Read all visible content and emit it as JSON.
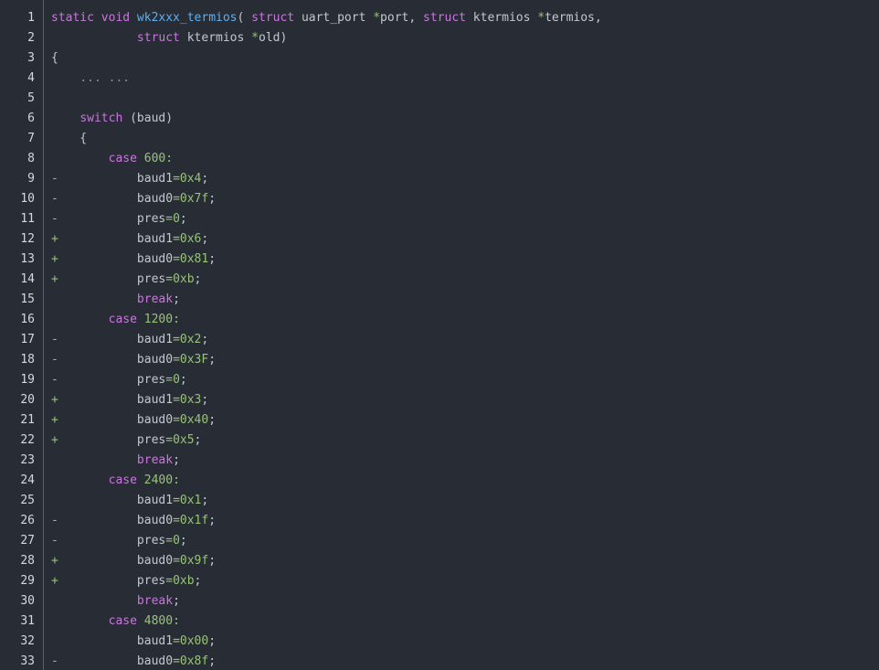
{
  "colors": {
    "background": "#282c34",
    "keyword": "#c678dd",
    "function": "#61afef",
    "number": "#98c379",
    "plain": "#c3c8d0",
    "line_number": "#d5d8de"
  },
  "lines": [
    {
      "n": "1",
      "tokens": [
        [
          "kw",
          "static void "
        ],
        [
          "fn",
          "wk2xxx_termios"
        ],
        [
          "plain",
          "( "
        ],
        [
          "kw",
          "struct"
        ],
        [
          "plain",
          " uart_port "
        ],
        [
          "op",
          "*"
        ],
        [
          "plain",
          "port, "
        ],
        [
          "kw",
          "struct"
        ],
        [
          "plain",
          " ktermios "
        ],
        [
          "op",
          "*"
        ],
        [
          "plain",
          "termios,"
        ]
      ]
    },
    {
      "n": "2",
      "tokens": [
        [
          "plain",
          "            "
        ],
        [
          "kw",
          "struct"
        ],
        [
          "plain",
          " ktermios "
        ],
        [
          "op",
          "*"
        ],
        [
          "plain",
          "old)"
        ]
      ]
    },
    {
      "n": "3",
      "tokens": [
        [
          "plain",
          "{"
        ]
      ]
    },
    {
      "n": "4",
      "tokens": [
        [
          "plain",
          "    "
        ],
        [
          "dots",
          "... ..."
        ]
      ]
    },
    {
      "n": "5",
      "tokens": []
    },
    {
      "n": "6",
      "tokens": [
        [
          "plain",
          "    "
        ],
        [
          "kw",
          "switch"
        ],
        [
          "plain",
          " (baud)"
        ]
      ]
    },
    {
      "n": "7",
      "tokens": [
        [
          "plain",
          "    {"
        ]
      ]
    },
    {
      "n": "8",
      "tokens": [
        [
          "plain",
          "        "
        ],
        [
          "kw",
          "case"
        ],
        [
          "plain",
          " "
        ],
        [
          "num",
          "600"
        ],
        [
          "op",
          ":"
        ]
      ]
    },
    {
      "n": "9",
      "tokens": [
        [
          "diff",
          "-"
        ],
        [
          "plain",
          "           baud1"
        ],
        [
          "op",
          "="
        ],
        [
          "num",
          "0x4"
        ],
        [
          "plain",
          ";"
        ]
      ]
    },
    {
      "n": "10",
      "tokens": [
        [
          "diff",
          "-"
        ],
        [
          "plain",
          "           baud0"
        ],
        [
          "op",
          "="
        ],
        [
          "num",
          "0x7f"
        ],
        [
          "plain",
          ";"
        ]
      ]
    },
    {
      "n": "11",
      "tokens": [
        [
          "diff",
          "-"
        ],
        [
          "plain",
          "           pres"
        ],
        [
          "op",
          "="
        ],
        [
          "num",
          "0"
        ],
        [
          "plain",
          ";"
        ]
      ]
    },
    {
      "n": "12",
      "tokens": [
        [
          "diff",
          "+"
        ],
        [
          "plain",
          "           baud1"
        ],
        [
          "op",
          "="
        ],
        [
          "num",
          "0x6"
        ],
        [
          "plain",
          ";"
        ]
      ]
    },
    {
      "n": "13",
      "tokens": [
        [
          "diff",
          "+"
        ],
        [
          "plain",
          "           baud0"
        ],
        [
          "op",
          "="
        ],
        [
          "num",
          "0x81"
        ],
        [
          "plain",
          ";"
        ]
      ]
    },
    {
      "n": "14",
      "tokens": [
        [
          "diff",
          "+"
        ],
        [
          "plain",
          "           pres"
        ],
        [
          "op",
          "="
        ],
        [
          "num",
          "0xb"
        ],
        [
          "plain",
          ";"
        ]
      ]
    },
    {
      "n": "15",
      "tokens": [
        [
          "plain",
          "            "
        ],
        [
          "kw",
          "break"
        ],
        [
          "plain",
          ";"
        ]
      ]
    },
    {
      "n": "16",
      "tokens": [
        [
          "plain",
          "        "
        ],
        [
          "kw",
          "case"
        ],
        [
          "plain",
          " "
        ],
        [
          "num",
          "1200"
        ],
        [
          "op",
          ":"
        ]
      ]
    },
    {
      "n": "17",
      "tokens": [
        [
          "diff",
          "-"
        ],
        [
          "plain",
          "           baud1"
        ],
        [
          "op",
          "="
        ],
        [
          "num",
          "0x2"
        ],
        [
          "plain",
          ";"
        ]
      ]
    },
    {
      "n": "18",
      "tokens": [
        [
          "diff",
          "-"
        ],
        [
          "plain",
          "           baud0"
        ],
        [
          "op",
          "="
        ],
        [
          "num",
          "0x3F"
        ],
        [
          "plain",
          ";"
        ]
      ]
    },
    {
      "n": "19",
      "tokens": [
        [
          "diff",
          "-"
        ],
        [
          "plain",
          "           pres"
        ],
        [
          "op",
          "="
        ],
        [
          "num",
          "0"
        ],
        [
          "plain",
          ";"
        ]
      ]
    },
    {
      "n": "20",
      "tokens": [
        [
          "diff",
          "+"
        ],
        [
          "plain",
          "           baud1"
        ],
        [
          "op",
          "="
        ],
        [
          "num",
          "0x3"
        ],
        [
          "plain",
          ";"
        ]
      ]
    },
    {
      "n": "21",
      "tokens": [
        [
          "diff",
          "+"
        ],
        [
          "plain",
          "           baud0"
        ],
        [
          "op",
          "="
        ],
        [
          "num",
          "0x40"
        ],
        [
          "plain",
          ";"
        ]
      ]
    },
    {
      "n": "22",
      "tokens": [
        [
          "diff",
          "+"
        ],
        [
          "plain",
          "           pres"
        ],
        [
          "op",
          "="
        ],
        [
          "num",
          "0x5"
        ],
        [
          "plain",
          ";"
        ]
      ]
    },
    {
      "n": "23",
      "tokens": [
        [
          "plain",
          "            "
        ],
        [
          "kw",
          "break"
        ],
        [
          "plain",
          ";"
        ]
      ]
    },
    {
      "n": "24",
      "tokens": [
        [
          "plain",
          "        "
        ],
        [
          "kw",
          "case"
        ],
        [
          "plain",
          " "
        ],
        [
          "num",
          "2400"
        ],
        [
          "op",
          ":"
        ]
      ]
    },
    {
      "n": "25",
      "tokens": [
        [
          "plain",
          "            baud1"
        ],
        [
          "op",
          "="
        ],
        [
          "num",
          "0x1"
        ],
        [
          "plain",
          ";"
        ]
      ]
    },
    {
      "n": "26",
      "tokens": [
        [
          "diff",
          "-"
        ],
        [
          "plain",
          "           baud0"
        ],
        [
          "op",
          "="
        ],
        [
          "num",
          "0x1f"
        ],
        [
          "plain",
          ";"
        ]
      ]
    },
    {
      "n": "27",
      "tokens": [
        [
          "diff",
          "-"
        ],
        [
          "plain",
          "           pres"
        ],
        [
          "op",
          "="
        ],
        [
          "num",
          "0"
        ],
        [
          "plain",
          ";"
        ]
      ]
    },
    {
      "n": "28",
      "tokens": [
        [
          "diff",
          "+"
        ],
        [
          "plain",
          "           baud0"
        ],
        [
          "op",
          "="
        ],
        [
          "num",
          "0x9f"
        ],
        [
          "plain",
          ";"
        ]
      ]
    },
    {
      "n": "29",
      "tokens": [
        [
          "diff",
          "+"
        ],
        [
          "plain",
          "           pres"
        ],
        [
          "op",
          "="
        ],
        [
          "num",
          "0xb"
        ],
        [
          "plain",
          ";"
        ]
      ]
    },
    {
      "n": "30",
      "tokens": [
        [
          "plain",
          "            "
        ],
        [
          "kw",
          "break"
        ],
        [
          "plain",
          ";"
        ]
      ]
    },
    {
      "n": "31",
      "tokens": [
        [
          "plain",
          "        "
        ],
        [
          "kw",
          "case"
        ],
        [
          "plain",
          " "
        ],
        [
          "num",
          "4800"
        ],
        [
          "op",
          ":"
        ]
      ]
    },
    {
      "n": "32",
      "tokens": [
        [
          "plain",
          "            baud1"
        ],
        [
          "op",
          "="
        ],
        [
          "num",
          "0x00"
        ],
        [
          "plain",
          ";"
        ]
      ]
    },
    {
      "n": "33",
      "tokens": [
        [
          "diff",
          "-"
        ],
        [
          "plain",
          "           baud0"
        ],
        [
          "op",
          "="
        ],
        [
          "num",
          "0x8f"
        ],
        [
          "plain",
          ";"
        ]
      ]
    }
  ]
}
